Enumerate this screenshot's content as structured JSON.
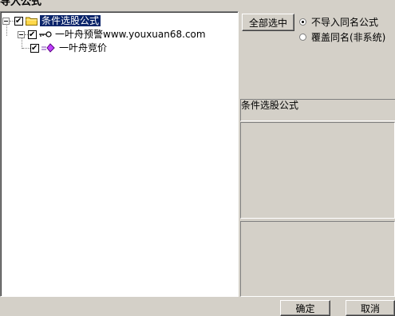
{
  "window": {
    "title": "导入公式"
  },
  "tree": {
    "root": {
      "label": "条件选股公式",
      "checked": true,
      "icon": "folder-icon"
    },
    "child": {
      "label": "一叶舟预警www.youxuan68.com",
      "checked": true,
      "icon": "key-icon"
    },
    "grandchild": {
      "label": "一叶舟竞价",
      "checked": true,
      "icon": "formula-diamond-icon"
    }
  },
  "controls": {
    "select_all_label": "全部选中",
    "radio_options": [
      {
        "label": "不导入同名公式",
        "checked": true
      },
      {
        "label": "覆盖同名(非系统)",
        "checked": false
      }
    ]
  },
  "info": {
    "formula_name": "条件选股公式"
  },
  "footer": {
    "ok_label": "确定",
    "cancel_label": "取消"
  },
  "colors": {
    "selection": "#0a246a",
    "face": "#d4d0c8",
    "folder": "#ffd84a"
  }
}
